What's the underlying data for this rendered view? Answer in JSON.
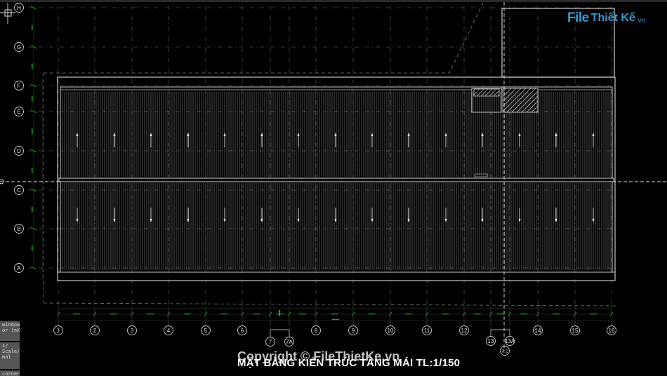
{
  "drawing": {
    "title": "MẶT BẰNG KIẾN TRÚC TẦNG MÁI TL:1/150",
    "watermark": "Copyright © FileThietKe.vn",
    "row_axes": [
      "H",
      "G",
      "F",
      "E",
      "D",
      "C",
      "B",
      "A"
    ],
    "column_axes": [
      "1",
      "2",
      "3",
      "4",
      "5",
      "6",
      "7",
      "7A",
      "8",
      "9",
      "10",
      "11",
      "12",
      "13",
      "13A",
      "14",
      "15",
      "16"
    ],
    "section_tag": "3.2",
    "colors": {
      "background": "#000000",
      "lines": "#c8c8c8",
      "dimension": "#16b316",
      "logo": "#2e9ad6"
    }
  },
  "logo": {
    "file": "File",
    "rest": "Thiết Kế",
    "vn": ".vn"
  },
  "command_panel": {
    "p1": "window,\nor (nX",
    "p2": "s/\nScale/\nmal",
    "p3": "corner"
  }
}
